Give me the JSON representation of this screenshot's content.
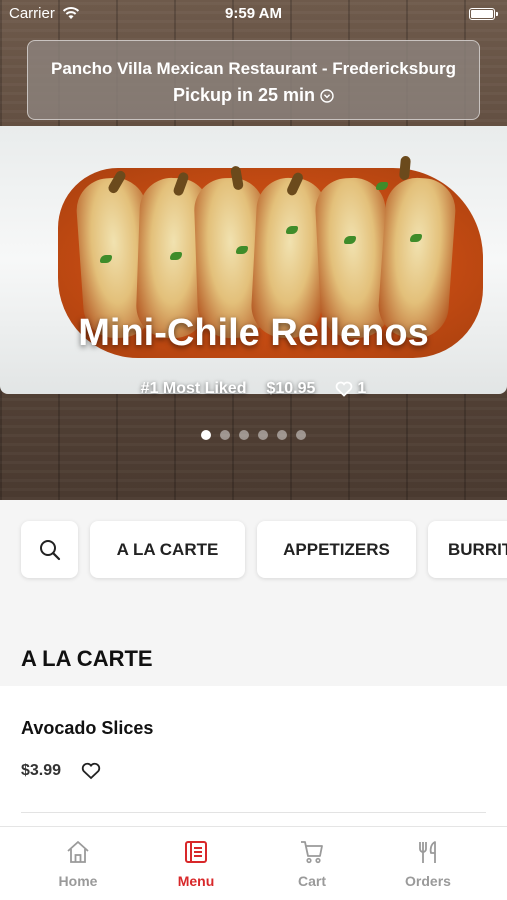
{
  "status_bar": {
    "carrier": "Carrier",
    "time": "9:59 AM"
  },
  "store": {
    "name": "Pancho Villa Mexican Restaurant - Fredericksburg",
    "pickup": "Pickup in 25 min"
  },
  "featured": {
    "title": "Mini-Chile Rellenos",
    "rank": "#1 Most Liked",
    "price": "$10.95",
    "likes": "1",
    "slide_count": 6,
    "active_slide": 1
  },
  "categories": [
    "A LA CARTE",
    "APPETIZERS",
    "BURRITOS"
  ],
  "section": {
    "title": "A LA CARTE"
  },
  "menu_items": [
    {
      "name": "Avocado Slices",
      "price": "$3.99"
    }
  ],
  "tabs": [
    {
      "label": "Home",
      "icon": "home-icon"
    },
    {
      "label": "Menu",
      "icon": "menu-book-icon"
    },
    {
      "label": "Cart",
      "icon": "cart-icon"
    },
    {
      "label": "Orders",
      "icon": "utensils-icon"
    }
  ],
  "active_tab": "Menu",
  "colors": {
    "accent": "#d8282a",
    "inactive": "#9a9a9a"
  }
}
